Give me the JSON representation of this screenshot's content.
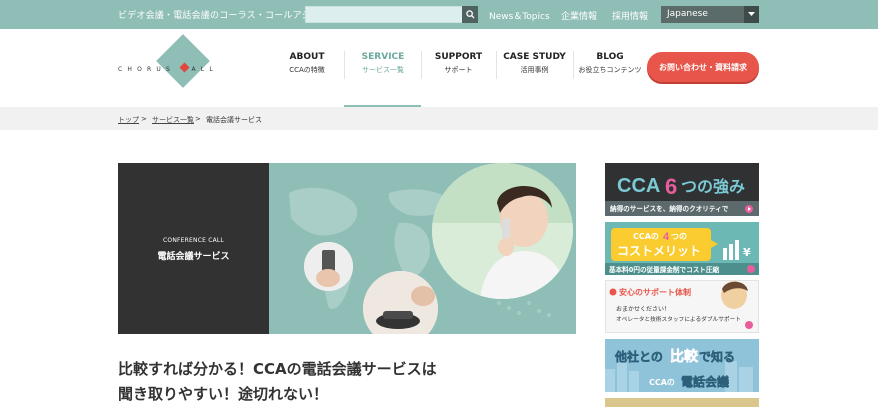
{
  "topbar": {
    "tagline": "ビデオ会議・電話会議のコーラス・コールアジア",
    "search_placeholder": "",
    "links": [
      "News＆Topics",
      "企業情報",
      "採用情報"
    ],
    "language": "Japanese"
  },
  "logo": {
    "text": "CHORUS CALL"
  },
  "nav": [
    {
      "en": "ABOUT",
      "jp": "CCAの特徴"
    },
    {
      "en": "SERVICE",
      "jp": "サービス一覧"
    },
    {
      "en": "SUPPORT",
      "jp": "サポート"
    },
    {
      "en": "CASE STUDY",
      "jp": "活用事例"
    },
    {
      "en": "BLOG",
      "jp": "お役立ちコンテンツ"
    }
  ],
  "contact_button": "お問い合わせ・資料請求",
  "breadcrumb": {
    "items": [
      "トップ",
      "サービス一覧",
      "電話会議サービス"
    ],
    "separator": ">"
  },
  "hero": {
    "label_small": "CONFERENCE CALL",
    "label_big": "電話会議サービス"
  },
  "headline": {
    "line1": "比較すれば分かる！CCAの電話会議サービスは",
    "line2": "聞き取りやすい！途切れない！"
  },
  "banners": {
    "b1_title_a": "CCA",
    "b1_title_num": "6",
    "b1_title_b": "つの強み",
    "b1_sub": "納得のサービスを、納得のクオリティで",
    "b2_top_a": "CCAの",
    "b2_top_num": "4",
    "b2_top_b": "つの",
    "b2_title": "コストメリット",
    "b2_sub": "基本料0円の従量課金制でコスト圧縮",
    "b3_title": "安心のサポート体制",
    "b3_line1": "おまかせください！",
    "b3_line2": "オペレータと技術スタッフによるダブルサポート",
    "b4_line1_a": "他社との",
    "b4_line1_b": "比較",
    "b4_line1_c": "で知る",
    "b4_line2_a": "CCAの",
    "b4_line2_b": "電話会議"
  },
  "colors": {
    "accent": "#8fbeb6",
    "contact": "#e8554a",
    "dark": "#323232"
  }
}
